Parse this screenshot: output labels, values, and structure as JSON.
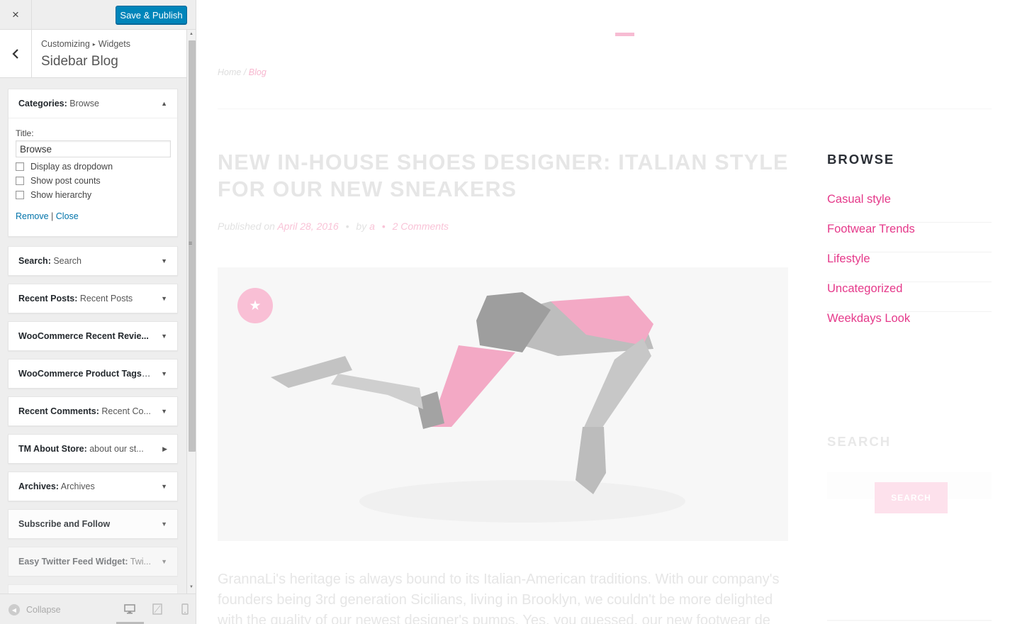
{
  "customizer": {
    "close_label": "×",
    "publish_label": "Save & Publish",
    "breadcrumb": [
      "Customizing",
      "Widgets"
    ],
    "section_title": "Sidebar Blog",
    "widgets": [
      {
        "name": "Categories:",
        "value": "Browse"
      },
      {
        "name": "Search:",
        "value": "Search"
      },
      {
        "name": "Recent Posts:",
        "value": "Recent Posts"
      },
      {
        "name": "WooCommerce Recent Revie...",
        "value": ""
      },
      {
        "name": "WooCommerce Product Tags:...",
        "value": ""
      },
      {
        "name": "Recent Comments:",
        "value": "Recent Co..."
      },
      {
        "name": "TM About Store:",
        "value": "about our st..."
      },
      {
        "name": "Archives:",
        "value": "Archives"
      },
      {
        "name": "Subscribe and Follow",
        "value": ""
      },
      {
        "name": "Easy Twitter Feed Widget:",
        "value": "Twi..."
      }
    ],
    "categories_form": {
      "title_label": "Title:",
      "title_value": "Browse",
      "options": [
        "Display as dropdown",
        "Show post counts",
        "Show hierarchy"
      ],
      "remove_label": "Remove",
      "separator": "|",
      "close_label": "Close"
    },
    "collapse_label": "Collapse"
  },
  "preview": {
    "breadcrumb_home": "Home",
    "breadcrumb_sep": " / ",
    "breadcrumb_current": "Blog",
    "post_title": "NEW IN-HOUSE SHOES DESIGNER: ITALIAN STYLE FOR OUR NEW SNEAKERS",
    "meta_published": "Published on",
    "meta_date": "April 28, 2016",
    "meta_by": "by",
    "meta_author": "a",
    "meta_comments": "2 Comments",
    "meta_dot": "•",
    "excerpt": "GrannaLi's heritage is always bound to its Italian-American traditions. With our company's founders being 3rd generation Sicilians, living in Brooklyn, we couldn't be more delighted with the quality of our newest designer's pumps. Yes, you guessed, our new footwear de",
    "sidebar": {
      "browse_title": "BROWSE",
      "categories": [
        "Casual style",
        "Footwear Trends",
        "Lifestyle",
        "Uncategorized",
        "Weekdays Look"
      ],
      "search_title": "SEARCH",
      "search_button": "SEARCH"
    }
  },
  "colors": {
    "accent_pink": "#e5398a",
    "publish_blue": "#0085ba",
    "link_blue": "#0073aa"
  }
}
